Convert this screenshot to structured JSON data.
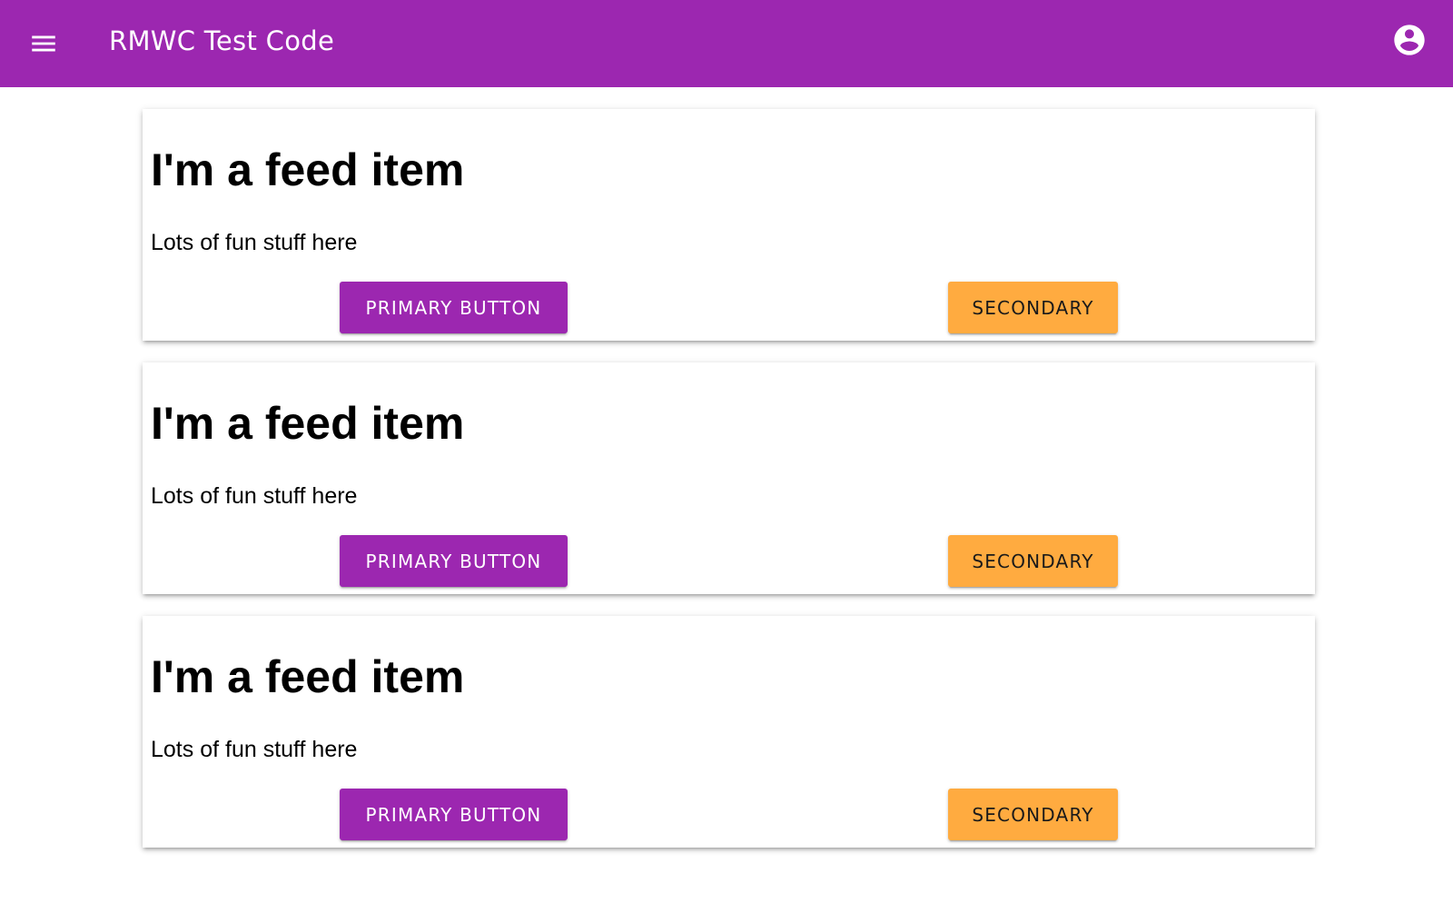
{
  "app_bar": {
    "title": "RMWC Test Code",
    "menu_icon": "menu-icon",
    "account_icon": "account-circle-icon",
    "color": "#9c27b0"
  },
  "feed": {
    "items": [
      {
        "title": "I'm a feed item",
        "body": "Lots of fun stuff here",
        "primary_label": "PRIMARY BUTTON",
        "secondary_label": "SECONDARY"
      },
      {
        "title": "I'm a feed item",
        "body": "Lots of fun stuff here",
        "primary_label": "PRIMARY BUTTON",
        "secondary_label": "SECONDARY"
      },
      {
        "title": "I'm a feed item",
        "body": "Lots of fun stuff here",
        "primary_label": "PRIMARY BUTTON",
        "secondary_label": "SECONDARY"
      }
    ]
  },
  "colors": {
    "primary": "#9c27b0",
    "secondary": "#ffab40"
  }
}
